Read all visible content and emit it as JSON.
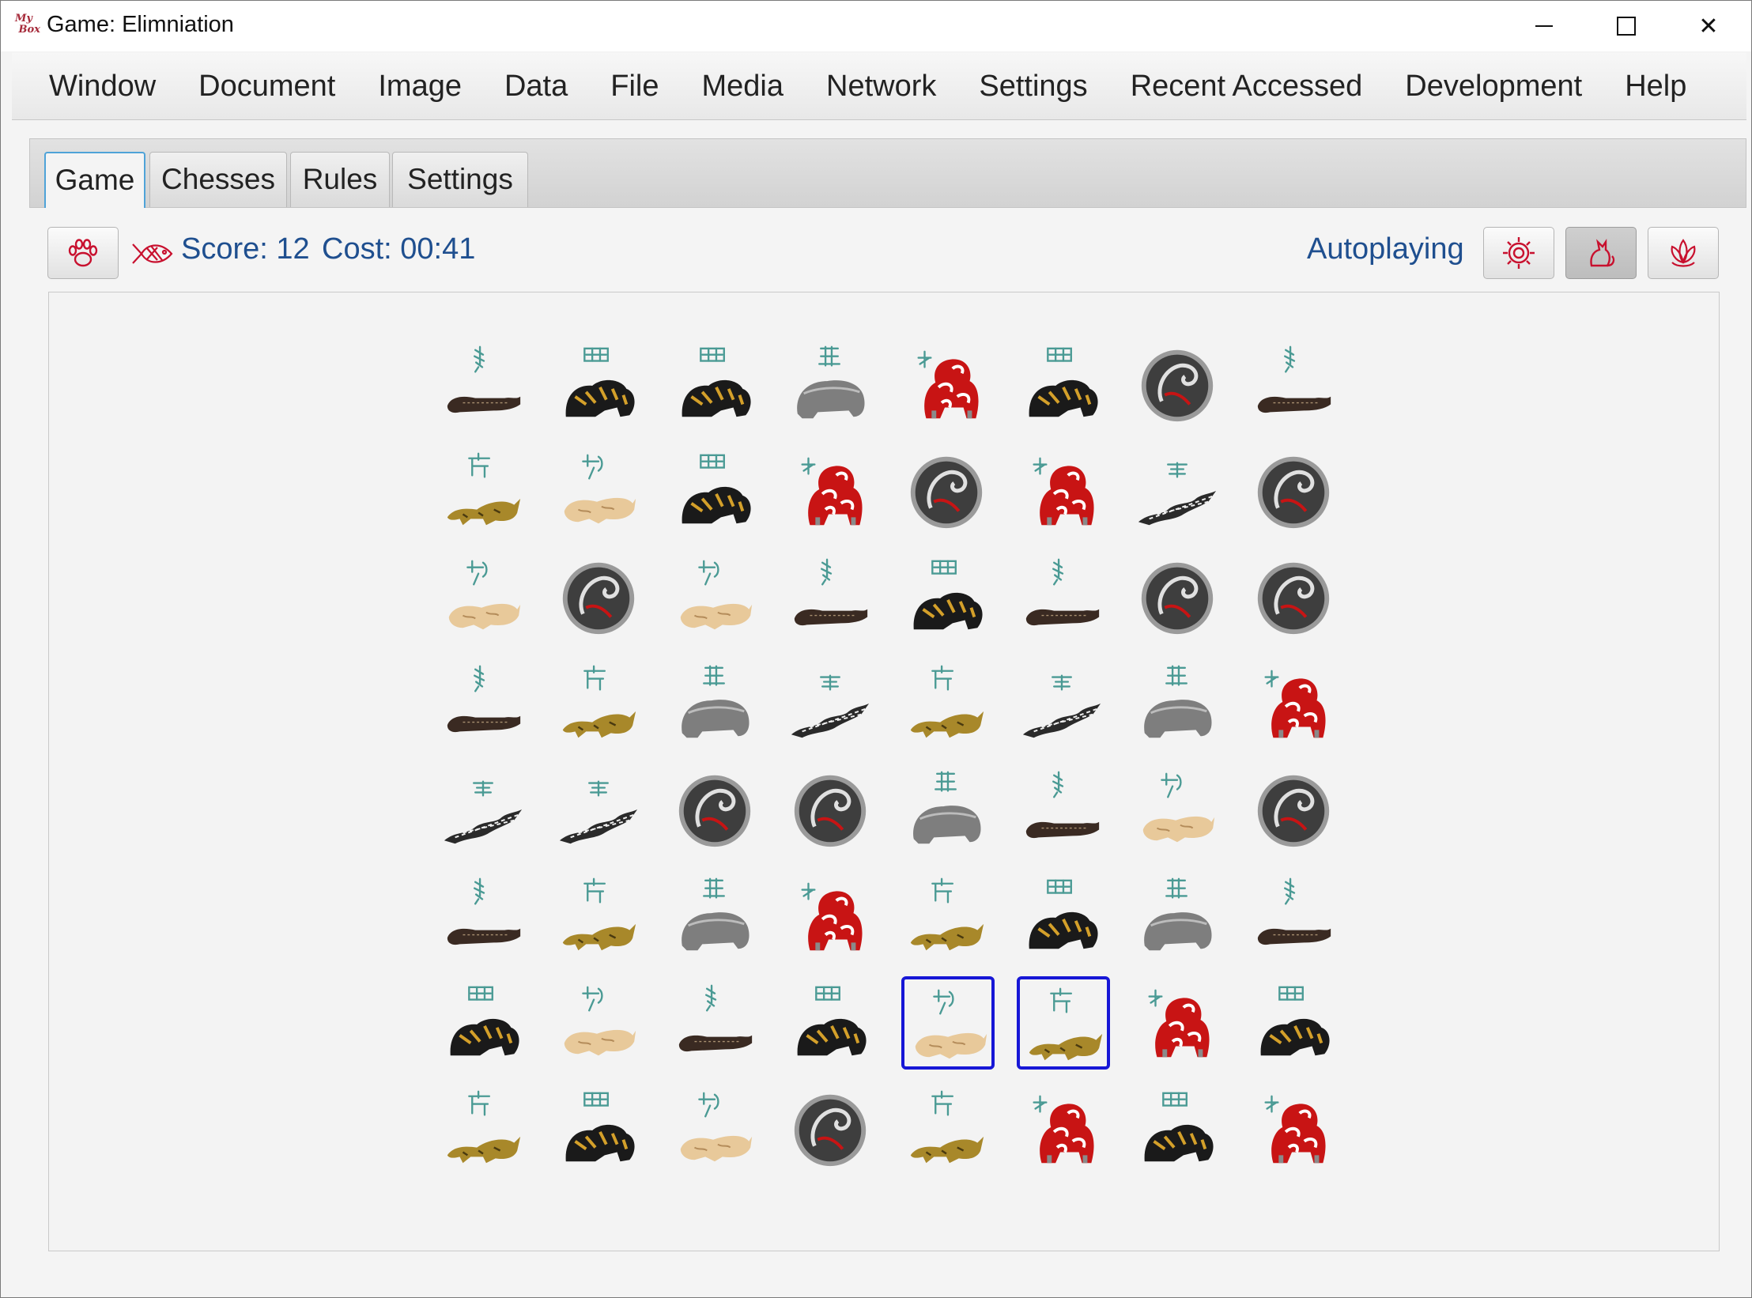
{
  "window": {
    "title": "Game: Elimniation",
    "logo": "MyBox",
    "controls": [
      "minimize-icon",
      "maximize-icon",
      "close-icon"
    ]
  },
  "menu": [
    "Window",
    "Document",
    "Image",
    "Data",
    "File",
    "Media",
    "Network",
    "Settings",
    "Recent Accessed",
    "Development",
    "Help"
  ],
  "tabs": [
    {
      "label": "Game",
      "active": true
    },
    {
      "label": "Chesses",
      "active": false
    },
    {
      "label": "Rules",
      "active": false
    },
    {
      "label": "Settings",
      "active": false
    }
  ],
  "toolbar": {
    "new_game_icon": "paw-icon",
    "score_icon": "fish-icon",
    "score_text": "Score: 12",
    "cost_text": "Cost: 00:41",
    "autoplay_label": "Autoplaying",
    "right_buttons": [
      {
        "icon": "gear-icon",
        "pressed": false
      },
      {
        "icon": "cat-icon",
        "pressed": true
      },
      {
        "icon": "lotus-icon",
        "pressed": false
      }
    ]
  },
  "colors": {
    "icon_red": "#c8102e",
    "status_blue": "#1f4f8f",
    "selection_blue": "#1717d6",
    "glyph_teal": "#4a9a94"
  },
  "board": {
    "rows": 8,
    "cols": 8,
    "legend": {
      "A": "black-lacquer-beast-tile",
      "B": "black-gold-striped-tiger-tile",
      "C": "grey-bear-tile",
      "D": "red-white-lion-tile",
      "E": "round-silver-disc-dragon-tile",
      "F": "gold-tiger-tile",
      "G": "pale-jade-tiger-tile",
      "H": "white-ink-dragon-tile"
    },
    "grid": [
      [
        "A",
        "B",
        "B",
        "C",
        "D",
        "B",
        "E",
        "A"
      ],
      [
        "F",
        "G",
        "B",
        "D",
        "E",
        "D",
        "H",
        "E"
      ],
      [
        "G",
        "E",
        "G",
        "A",
        "B",
        "A",
        "E",
        "E"
      ],
      [
        "A",
        "F",
        "C",
        "H",
        "F",
        "H",
        "C",
        "D"
      ],
      [
        "H",
        "H",
        "E",
        "E",
        "C",
        "A",
        "G",
        "E"
      ],
      [
        "A",
        "F",
        "C",
        "D",
        "F",
        "B",
        "C",
        "A"
      ],
      [
        "B",
        "G",
        "A",
        "B",
        "G",
        "F",
        "D",
        "B"
      ],
      [
        "F",
        "B",
        "G",
        "E",
        "F",
        "D",
        "B",
        "D"
      ]
    ],
    "selected": [
      [
        6,
        4
      ],
      [
        6,
        5
      ]
    ]
  }
}
